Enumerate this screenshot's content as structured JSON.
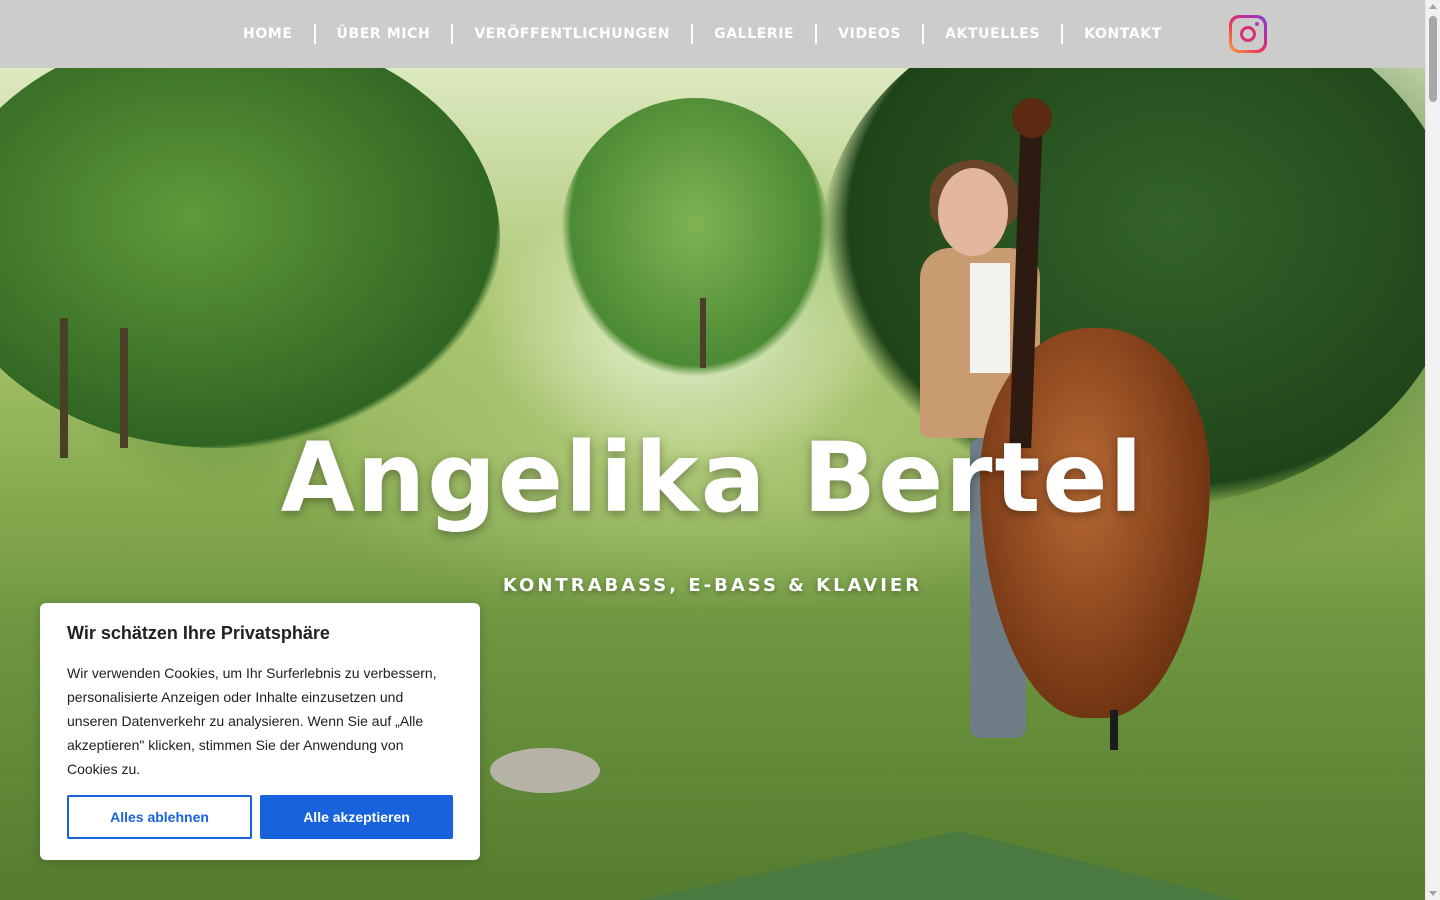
{
  "nav": {
    "items": [
      {
        "label": "HOME"
      },
      {
        "label": "ÜBER MICH"
      },
      {
        "label": "VERÖFFENTLICHUNGEN"
      },
      {
        "label": "GALLERIE"
      },
      {
        "label": "VIDEOS"
      },
      {
        "label": "AKTUELLES"
      },
      {
        "label": "KONTAKT"
      }
    ],
    "social_icon": "instagram-icon"
  },
  "hero": {
    "title": "Angelika Bertel",
    "subtitle": "KONTRABASS, E-BASS & KLAVIER"
  },
  "cookie_banner": {
    "title": "Wir schätzen Ihre Privatsphäre",
    "text": "Wir verwenden Cookies, um Ihr Surferlebnis zu verbessern, personalisierte Anzeigen oder Inhalte einzusetzen und unseren Datenverkehr zu analysieren. Wenn Sie auf „Alle akzeptieren\" klicken, stimmen Sie der Anwendung von Cookies zu.",
    "reject_label": "Alles ablehnen",
    "accept_label": "Alle akzeptieren"
  },
  "colors": {
    "header_bg": "#cccccb",
    "accent_blue": "#1863dc",
    "divider_green": "#4a7a3f"
  }
}
